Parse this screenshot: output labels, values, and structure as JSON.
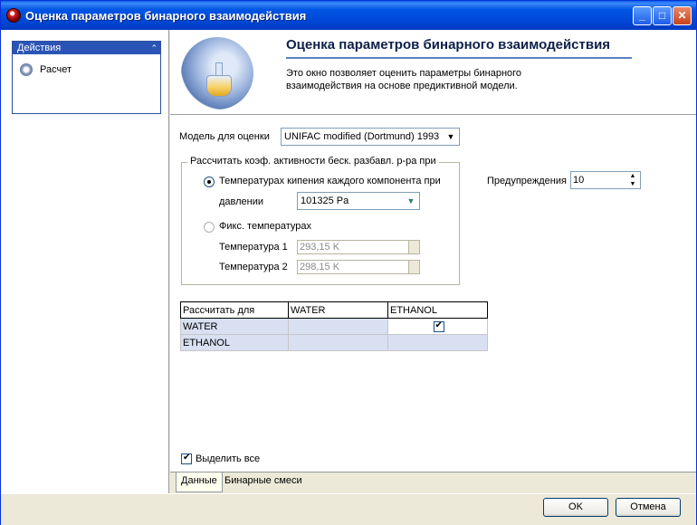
{
  "window": {
    "title": "Оценка параметров бинарного взаимодействия",
    "controls": {
      "minimize": "_",
      "maximize": "□",
      "close": "✕"
    }
  },
  "sidebar": {
    "header": "Действия",
    "collapse_glyph": "⌃",
    "items": [
      {
        "label": "Расчет",
        "icon": "calculate-icon"
      }
    ]
  },
  "header": {
    "title": "Оценка параметров бинарного взаимодействия",
    "description": "Это окно позволяет оценить параметры бинарного взаимодействия на основе предиктивной модели."
  },
  "form": {
    "model_label": "Модель для оценки",
    "model_value": "UNIFAC modified (Dortmund) 1993",
    "group_title": "Рассчитать коэф. активности беск. разбавл. р-ра при",
    "option_boiling": "Температурах кипения каждого компонента при",
    "pressure_label": "давлении",
    "pressure_value": "101325 Pa",
    "option_fixed": "Фикс. температурах",
    "temp1_label": "Температура 1",
    "temp1_value": "293,15 K",
    "temp2_label": "Температура 2",
    "temp2_value": "298,15 K",
    "warnings_label": "Предупреждения",
    "warnings_value": "10",
    "selected_option": "boiling"
  },
  "grid": {
    "corner": "Рассчитать для",
    "columns": [
      "WATER",
      "ETHANOL"
    ],
    "rows": [
      {
        "label": "WATER",
        "cells": [
          "",
          "checked"
        ]
      },
      {
        "label": "ETHANOL",
        "cells": [
          "",
          ""
        ]
      }
    ]
  },
  "select_all": {
    "label": "Выделить все",
    "checked": true
  },
  "tabs": [
    "Данные",
    "Бинарные смеси"
  ],
  "active_tab": "Данные",
  "buttons": {
    "ok": "OK",
    "cancel": "Отмена"
  },
  "colors": {
    "title_bar": "#0055e5",
    "sidebar_header": "#2b54b6",
    "grid_highlight": "#d8e0f2"
  }
}
